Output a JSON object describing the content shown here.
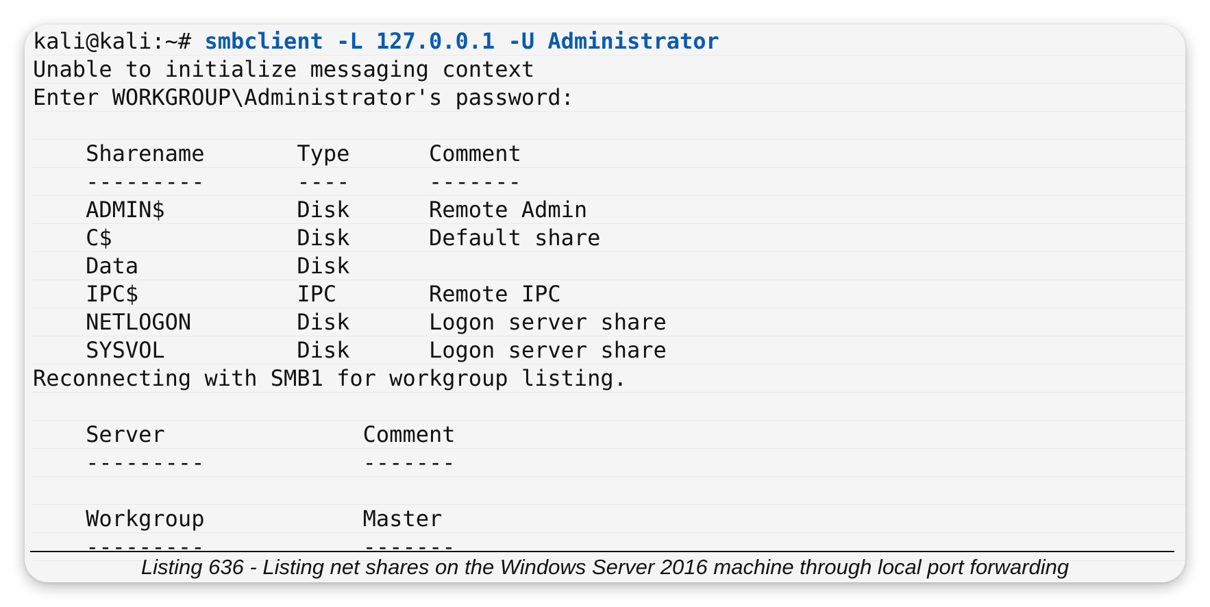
{
  "terminal": {
    "prompt": "kali@kali:~# ",
    "command": "smbclient -L 127.0.0.1 -U Administrator",
    "output": {
      "line1": "Unable to initialize messaging context",
      "line2": "Enter WORKGROUP\\Administrator's password:",
      "line3": "",
      "share_header": "    Sharename       Type      Comment",
      "share_divider": "    ---------       ----      -------",
      "shares": [
        "    ADMIN$          Disk      Remote Admin",
        "    C$              Disk      Default share",
        "    Data            Disk",
        "    IPC$            IPC       Remote IPC",
        "    NETLOGON        Disk      Logon server share",
        "    SYSVOL          Disk      Logon server share"
      ],
      "reconnect": "Reconnecting with SMB1 for workgroup listing.",
      "blank2": "",
      "server_header": "    Server               Comment",
      "server_divider": "    ---------            -------",
      "blank3": "",
      "workgroup_header": "    Workgroup            Master",
      "workgroup_divider": "    ---------            -------"
    }
  },
  "caption": "Listing 636 - Listing net shares on the Windows Server 2016 machine through local port forwarding",
  "colors": {
    "command": "#0b5bb0",
    "text": "#111111",
    "background": "#f5f5f5"
  }
}
